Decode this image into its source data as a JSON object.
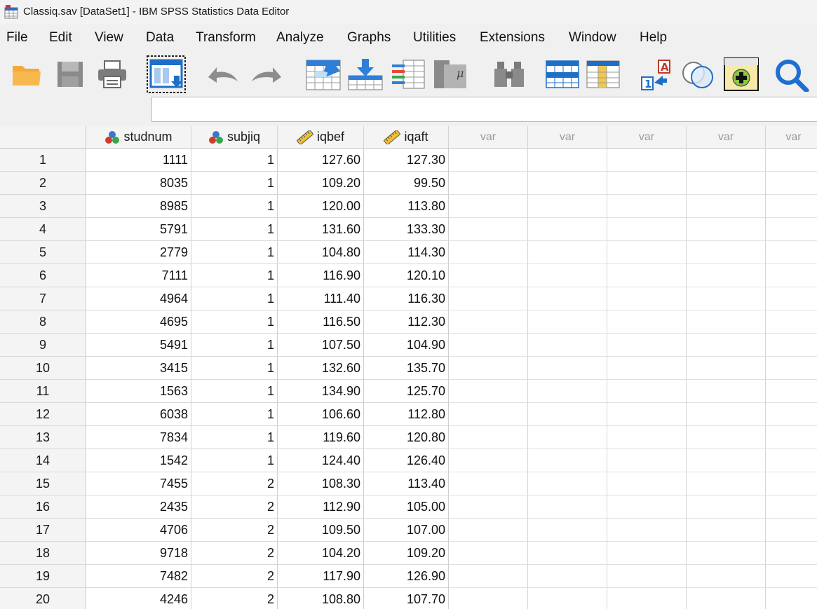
{
  "window": {
    "title": "Classiq.sav [DataSet1] - IBM SPSS Statistics Data Editor"
  },
  "menu": [
    "File",
    "Edit",
    "View",
    "Data",
    "Transform",
    "Analyze",
    "Graphs",
    "Utilities",
    "Extensions",
    "Window",
    "Help"
  ],
  "toolbar": {
    "icons": [
      "open-folder-icon",
      "save-icon",
      "print-icon",
      "dialog-recall-icon",
      "undo-icon",
      "redo-icon",
      "goto-case-icon",
      "goto-variable-icon",
      "variables-icon",
      "run-descriptives-icon",
      "find-icon",
      "insert-cases-icon",
      "insert-variable-icon",
      "value-labels-icon",
      "use-variable-sets-icon",
      "show-all-variables-icon",
      "search-icon"
    ]
  },
  "colors": {
    "menubar_bg": "#f0f0f0",
    "header_bg": "#f4f4f4",
    "nominal_icon": "#c0392b",
    "scale_icon": "#d4a017",
    "search_blue": "#1f6fd1"
  },
  "grid": {
    "columns": [
      {
        "name": "studnum",
        "type": "nominal"
      },
      {
        "name": "subjiq",
        "type": "nominal"
      },
      {
        "name": "iqbef",
        "type": "scale"
      },
      {
        "name": "iqaft",
        "type": "scale"
      },
      {
        "name": "var",
        "type": "empty"
      },
      {
        "name": "var",
        "type": "empty"
      },
      {
        "name": "var",
        "type": "empty"
      },
      {
        "name": "var",
        "type": "empty"
      },
      {
        "name": "var",
        "type": "empty"
      }
    ],
    "rows": [
      [
        "1",
        "1111",
        "1",
        "127.60",
        "127.30"
      ],
      [
        "2",
        "8035",
        "1",
        "109.20",
        "99.50"
      ],
      [
        "3",
        "8985",
        "1",
        "120.00",
        "113.80"
      ],
      [
        "4",
        "5791",
        "1",
        "131.60",
        "133.30"
      ],
      [
        "5",
        "2779",
        "1",
        "104.80",
        "114.30"
      ],
      [
        "6",
        "7111",
        "1",
        "116.90",
        "120.10"
      ],
      [
        "7",
        "4964",
        "1",
        "111.40",
        "116.30"
      ],
      [
        "8",
        "4695",
        "1",
        "116.50",
        "112.30"
      ],
      [
        "9",
        "5491",
        "1",
        "107.50",
        "104.90"
      ],
      [
        "10",
        "3415",
        "1",
        "132.60",
        "135.70"
      ],
      [
        "11",
        "1563",
        "1",
        "134.90",
        "125.70"
      ],
      [
        "12",
        "6038",
        "1",
        "106.60",
        "112.80"
      ],
      [
        "13",
        "7834",
        "1",
        "119.60",
        "120.80"
      ],
      [
        "14",
        "1542",
        "1",
        "124.40",
        "126.40"
      ],
      [
        "15",
        "7455",
        "2",
        "108.30",
        "113.40"
      ],
      [
        "16",
        "2435",
        "2",
        "112.90",
        "105.00"
      ],
      [
        "17",
        "4706",
        "2",
        "109.50",
        "107.00"
      ],
      [
        "18",
        "9718",
        "2",
        "104.20",
        "109.20"
      ],
      [
        "19",
        "7482",
        "2",
        "117.90",
        "126.90"
      ],
      [
        "20",
        "4246",
        "2",
        "108.80",
        "107.70"
      ]
    ]
  }
}
